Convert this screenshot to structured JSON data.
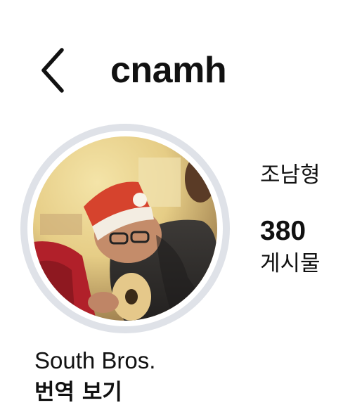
{
  "header": {
    "back_icon": "chevron-left-icon",
    "username": "cnamh"
  },
  "profile": {
    "avatar_description": "profile-photo",
    "ring_color": "#dfe2e8",
    "display_name": "조남형",
    "posts_count": "380",
    "posts_label": "게시물",
    "bio": "South Bros.",
    "translate_label": "번역 보기"
  }
}
